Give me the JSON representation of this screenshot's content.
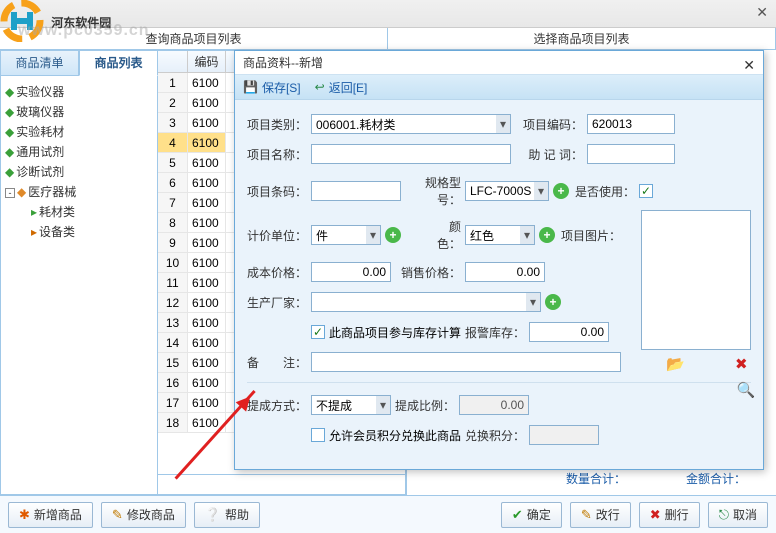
{
  "watermark": {
    "text": "河东软件园",
    "url": "www.pc0359.cn"
  },
  "headers": {
    "left": "查询商品项目列表",
    "right": "选择商品项目列表"
  },
  "tabs": {
    "list_tab": "商品清单",
    "prod_tab": "商品列表"
  },
  "tree": {
    "n1": "实验仪器",
    "n2": "玻璃仪器",
    "n3": "实验耗材",
    "n4": "通用试剂",
    "n5": "诊断试剂",
    "n6": "医疗器械",
    "n6a": "耗材类",
    "n6b": "设备类"
  },
  "grid": {
    "col0": "编码",
    "rows": [
      {
        "n": "1",
        "c": "6100"
      },
      {
        "n": "2",
        "c": "6100"
      },
      {
        "n": "3",
        "c": "6100"
      },
      {
        "n": "4",
        "c": "6100"
      },
      {
        "n": "5",
        "c": "6100"
      },
      {
        "n": "6",
        "c": "6100"
      },
      {
        "n": "7",
        "c": "6100"
      },
      {
        "n": "8",
        "c": "6100"
      },
      {
        "n": "9",
        "c": "6100"
      },
      {
        "n": "10",
        "c": "6100"
      },
      {
        "n": "11",
        "c": "6100"
      },
      {
        "n": "12",
        "c": "6100"
      },
      {
        "n": "13",
        "c": "6100"
      },
      {
        "n": "14",
        "c": "6100"
      },
      {
        "n": "15",
        "c": "6100"
      },
      {
        "n": "16",
        "c": "6100"
      },
      {
        "n": "17",
        "c": "6100"
      },
      {
        "n": "18",
        "c": "6100"
      }
    ],
    "foot1": "数量合计：",
    "foot2": "金额合计："
  },
  "buttons": {
    "add": "新增商品",
    "edit": "修改商品",
    "help": "帮助",
    "ok": "确定",
    "modify": "改行",
    "del": "删行",
    "cancel": "取消"
  },
  "modal": {
    "title": "商品资料--新增",
    "save": "保存[S]",
    "back": "返回[E]",
    "lbl_cat": "项目类别：",
    "cat_val": "006001.耗材类",
    "lbl_code": "项目编码：",
    "code_val": "620013",
    "lbl_name": "项目名称：",
    "lbl_mnemonic": "助 记 词：",
    "lbl_barcode": "项目条码：",
    "lbl_spec": "规格型号：",
    "spec_val": "LFC-7000S",
    "lbl_enable": "是否使用：",
    "lbl_unit": "计价单位：",
    "unit_val": "件",
    "lbl_color": "颜　　色：",
    "color_val": "红色",
    "lbl_img": "项目图片：",
    "lbl_cost": "成本价格：",
    "cost_val": "0.00",
    "lbl_sale": "销售价格：",
    "sale_val": "0.00",
    "lbl_mfr": "生产厂家：",
    "chk_stock": "此商品项目参与库存计算",
    "lbl_warn": "报警库存：",
    "warn_val": "0.00",
    "lbl_remark": "备　　注：",
    "lbl_comm": "提成方式：",
    "comm_val": "不提成",
    "lbl_rate": "提成比例：",
    "rate_val": "0.00",
    "chk_points": "允许会员积分兑换此商品",
    "lbl_redeem": "兑换积分：",
    "check_mark": "✓"
  }
}
